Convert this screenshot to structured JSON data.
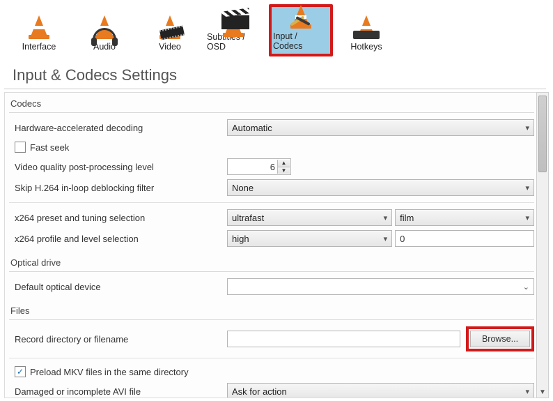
{
  "toolbar": {
    "tabs": [
      {
        "label": "Interface"
      },
      {
        "label": "Audio"
      },
      {
        "label": "Video"
      },
      {
        "label": "Subtitles / OSD"
      },
      {
        "label": "Input / Codecs"
      },
      {
        "label": "Hotkeys"
      }
    ]
  },
  "page_title": "Input & Codecs Settings",
  "groups": {
    "codecs": {
      "title": "Codecs",
      "hw_decoding_label": "Hardware-accelerated decoding",
      "hw_decoding_value": "Automatic",
      "fast_seek_label": "Fast seek",
      "fast_seek_checked": false,
      "video_quality_label": "Video quality post-processing level",
      "video_quality_value": "6",
      "skip_loop_label": "Skip H.264 in-loop deblocking filter",
      "skip_loop_value": "None",
      "x264_preset_label": "x264 preset and tuning selection",
      "x264_preset_value": "ultrafast",
      "x264_tuning_value": "film",
      "x264_profile_label": "x264 profile and level selection",
      "x264_profile_value": "high",
      "x264_level_value": "0"
    },
    "optical": {
      "title": "Optical drive",
      "default_device_label": "Default optical device",
      "default_device_value": ""
    },
    "files": {
      "title": "Files",
      "record_dir_label": "Record directory or filename",
      "record_dir_value": "",
      "browse_label": "Browse...",
      "preload_mkv_label": "Preload MKV files in the same directory",
      "preload_mkv_checked": true,
      "avi_label": "Damaged or incomplete AVI file",
      "avi_value": "Ask for action"
    }
  }
}
